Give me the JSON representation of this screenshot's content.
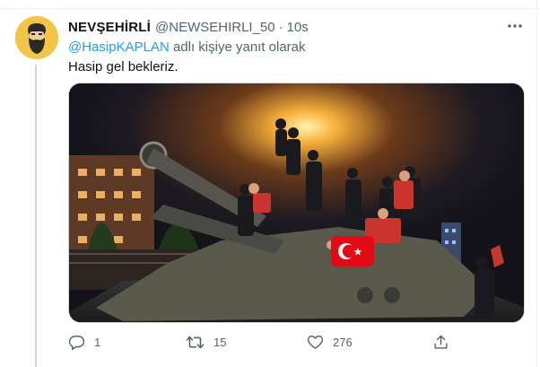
{
  "tweet": {
    "display_name": "NEVŞEHİRLİ",
    "handle": "@NEWSEHIRLI_50",
    "separator": "·",
    "time": "10s",
    "reply_mention": "@HasipKAPLAN",
    "reply_suffix": "adlı kişiye yanıt olarak",
    "text": "Hasip gel bekleriz."
  },
  "actions": {
    "reply_count": "1",
    "retweet_count": "15",
    "like_count": "276",
    "share_count": ""
  },
  "icons": {
    "avatar": "bearded-man-avatar",
    "more": "more-options-icon",
    "reply": "reply-icon",
    "retweet": "retweet-icon",
    "like": "heart-icon",
    "share": "share-icon"
  },
  "media": {
    "description_kind": "photo",
    "flag_color": "#e30a17"
  },
  "colors": {
    "accent": "#1d9bf0",
    "secondary_text": "#536471",
    "avatar_bg": "#f2c447"
  }
}
